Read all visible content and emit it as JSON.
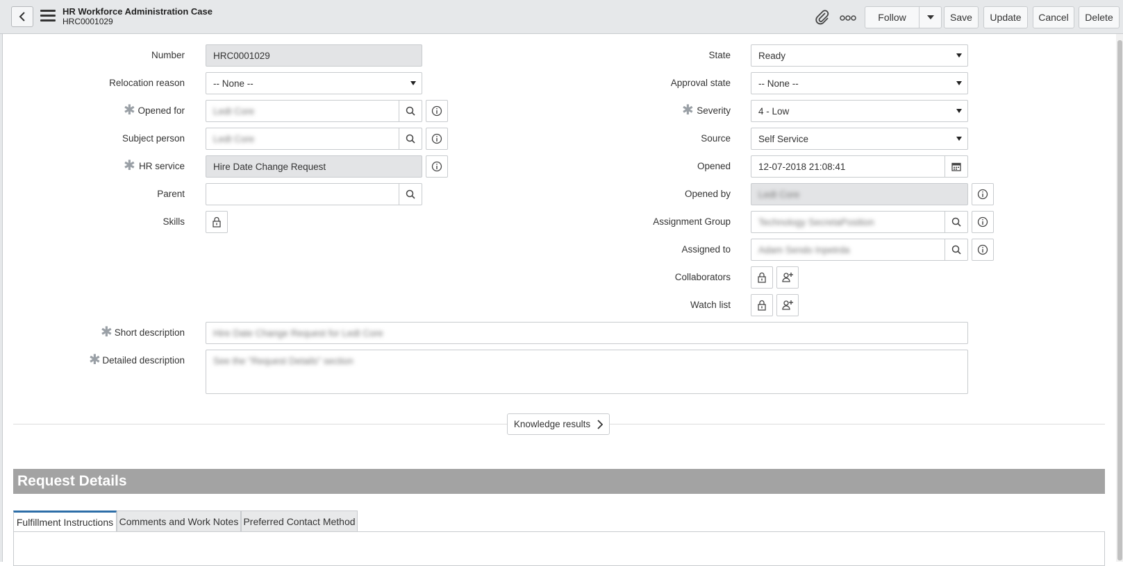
{
  "header": {
    "title": "HR Workforce Administration Case",
    "number": "HRC0001029",
    "follow_label": "Follow",
    "save_label": "Save",
    "update_label": "Update",
    "cancel_label": "Cancel",
    "delete_label": "Delete"
  },
  "form": {
    "left": {
      "number_label": "Number",
      "number_value": "HRC0001029",
      "relocation_label": "Relocation reason",
      "relocation_value": "-- None --",
      "opened_for_label": "Opened for",
      "opened_for_value": "Ledt Core",
      "subject_label": "Subject person",
      "subject_value": "Ledt Core",
      "hr_service_label": "HR service",
      "hr_service_value": "Hire Date Change Request",
      "parent_label": "Parent",
      "parent_value": "",
      "skills_label": "Skills"
    },
    "right": {
      "state_label": "State",
      "state_value": "Ready",
      "approval_label": "Approval state",
      "approval_value": "-- None --",
      "severity_label": "Severity",
      "severity_value": "4 - Low",
      "source_label": "Source",
      "source_value": "Self Service",
      "opened_label": "Opened",
      "opened_value": "12-07-2018 21:08:41",
      "opened_by_label": "Opened by",
      "opened_by_value": "Ledt Core",
      "assignment_group_label": "Assignment Group",
      "assignment_group_value": "Technology SecretaPosition",
      "assigned_to_label": "Assigned to",
      "assigned_to_value": "Adam Sendo Inpetrda",
      "collaborators_label": "Collaborators",
      "watch_list_label": "Watch list"
    },
    "short_desc_label": "Short description",
    "short_desc_value": "Hire Date Change Request for Ledt Core",
    "detailed_desc_label": "Detailed description",
    "detailed_desc_value": "See the \"Request Details\" section",
    "knowledge_label": "Knowledge results"
  },
  "section": {
    "title": "Request Details",
    "tabs": [
      "Fulfillment Instructions",
      "Comments and Work Notes",
      "Preferred Contact Method"
    ]
  }
}
